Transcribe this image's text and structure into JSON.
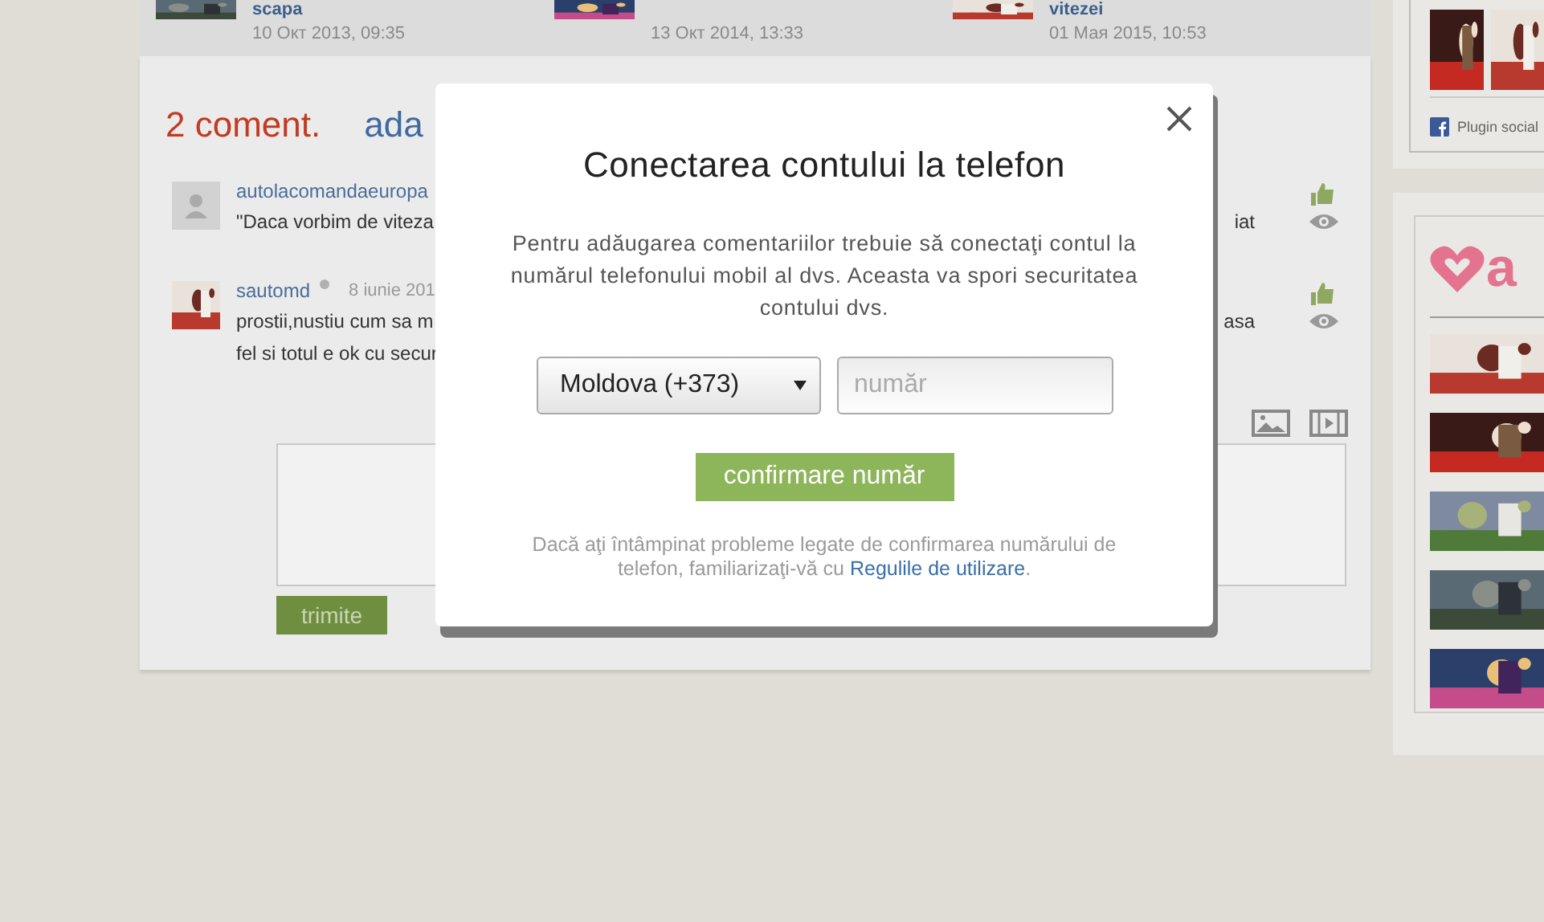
{
  "related_articles": [
    {
      "title": "scapa",
      "date": "10 Окт 2013, 09:35"
    },
    {
      "date": "13 Окт 2014, 13:33"
    },
    {
      "title": "vitezei",
      "date": "01 Мая 2015, 10:53"
    }
  ],
  "comments_header": {
    "count": "2 coment.",
    "add_link": "ada"
  },
  "comments": [
    {
      "avatar": {
        "kind": "placeholder"
      },
      "author": "autolacomandaeuropa",
      "lines": [
        {
          "left": "\"Daca vorbim de viteza",
          "right": "iat"
        }
      ]
    },
    {
      "avatar": {
        "kind": "picture"
      },
      "author": "sautomd",
      "date": "8 iunie 201",
      "lines": [
        {
          "left": "prostii,nustiu cum sa m",
          "right": "asa"
        },
        {
          "left": "fel si totul e ok cu secur"
        }
      ]
    }
  ],
  "reply_form": {
    "submit": "trimite"
  },
  "sidebar": {
    "facebook_plugin": "Plugin social",
    "logo_text": "a"
  },
  "modal": {
    "title": "Conectarea contului la telefon",
    "message": "Pentru adăugarea comentariilor trebuie să conectaţi contul la numărul telefonului mobil al dvs. Aceasta va spori securitatea contului dvs.",
    "country_select": "Moldova (+373)",
    "number_placeholder": "număr",
    "confirm_button": "confirmare număr",
    "help_text": "Dacă aţi întâmpinat probleme legate de confirmarea numărului de telefon, familiarizaţi-vă cu ",
    "help_link": "Regulile de utilizare",
    "help_end": "."
  }
}
